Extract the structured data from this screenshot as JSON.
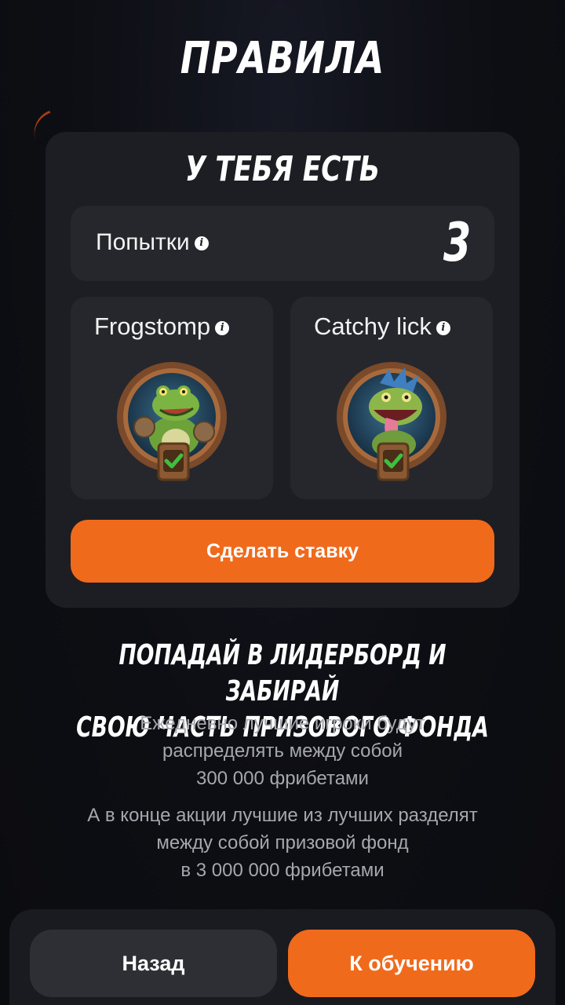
{
  "header": {
    "title": "ПРАВИЛА"
  },
  "card": {
    "title": "У ТЕБЯ ЕСТЬ",
    "attempts": {
      "label": "Попытки",
      "value": "3",
      "info_icon": "info-icon"
    },
    "games": [
      {
        "name": "Frogstomp",
        "info_icon": "info-icon",
        "avatar": "frog-character-avatar",
        "status_icon": "checkmark-icon"
      },
      {
        "name": "Catchy lick",
        "info_icon": "info-icon",
        "avatar": "lizard-character-avatar",
        "status_icon": "checkmark-icon"
      }
    ],
    "bet_button_label": "Сделать ставку"
  },
  "promo": {
    "heading_line1": "ПОПАДАЙ В ЛИДЕРБОРД И ЗАБИРАЙ",
    "heading_line2": "СВОЮ ЧАСТЬ ПРИЗОВОГО ФОНДА",
    "paragraph1": "Ежедневно лучшие игроки будут\nраспределять между собой\n300 000 фрибетами",
    "paragraph2": "А в конце акции лучшие из лучших разделят\nмежду собой призовой фонд\nв 3 000 000 фрибетами"
  },
  "footer": {
    "back_label": "Назад",
    "next_label": "К обучению"
  },
  "colors": {
    "accent": "#f06a1c",
    "background": "#0d0e13",
    "card": "#1d1e23",
    "tile": "#26272c",
    "muted_text": "#a6a7ad",
    "check_green": "#3fbf3f"
  }
}
